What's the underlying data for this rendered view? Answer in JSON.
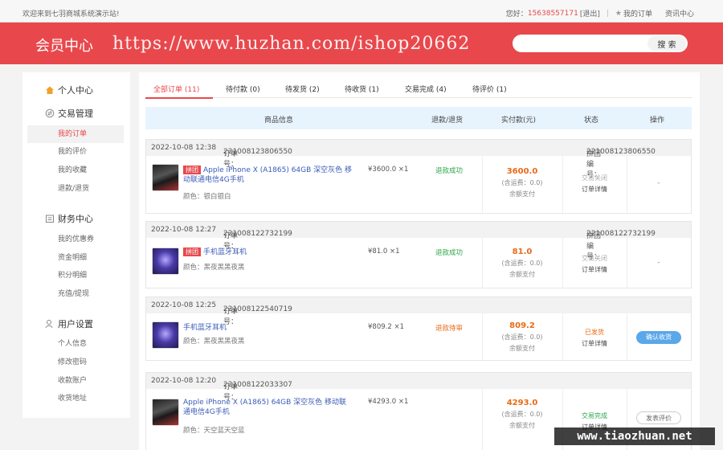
{
  "topbar": {
    "welcome": "欢迎来到七羽商城系统演示站!",
    "greeting": "您好：",
    "phone": "15638557171",
    "logout": "[退出]",
    "my_orders": "我的订单",
    "news": "资讯中心"
  },
  "header": {
    "title": "会员中心",
    "watermark": "https://www.huzhan.com/ishop20662"
  },
  "search": {
    "placeholder": "",
    "button": "搜 索"
  },
  "sidebar": {
    "personal_center": "个人中心",
    "groups": [
      {
        "title": "交易管理",
        "icon": "exchange-icon",
        "items": [
          "我的订单",
          "我的评价",
          "我的收藏",
          "退款/退货"
        ]
      },
      {
        "title": "财务中心",
        "icon": "wallet-icon",
        "items": [
          "我的优惠券",
          "资金明细",
          "积分明细",
          "充值/提现"
        ]
      },
      {
        "title": "用户设置",
        "icon": "user-icon",
        "items": [
          "个人信息",
          "修改密码",
          "收款账户",
          "收货地址"
        ]
      }
    ],
    "active_item": "我的订单"
  },
  "tabs": [
    {
      "label": "全部订单",
      "count": "(11)"
    },
    {
      "label": "待付款",
      "count": "(0)"
    },
    {
      "label": "待发货",
      "count": "(2)"
    },
    {
      "label": "待收货",
      "count": "(1)"
    },
    {
      "label": "交易完成",
      "count": "(4)"
    },
    {
      "label": "待评价",
      "count": "(1)"
    }
  ],
  "table_headers": [
    "商品信息",
    "退款/退货",
    "实付款(元)",
    "状态",
    "操作"
  ],
  "orders": [
    {
      "time": "2022-10-08 12:38",
      "order_no_label": "订单号：",
      "order_no": "221008123806550",
      "group_label": "拼团编号：",
      "group_no": "221008123806550",
      "badge": "拼团",
      "name": "Apple iPhone X (A1865) 64GB 深空灰色 移动联通电信4G手机",
      "attr": "颜色：银白银白",
      "price": "¥3600.0",
      "qty": "×1",
      "refund": "退款成功",
      "amount": "3600.0",
      "shipping": "(含运费：0.0)",
      "pay_method": "余额支付",
      "status": "交易关闭",
      "detail": "订单详情",
      "op": "-"
    },
    {
      "time": "2022-10-08 12:27",
      "order_no_label": "订单号：",
      "order_no": "221008122732199",
      "group_label": "拼团编号：",
      "group_no": "221008122732199",
      "badge": "拼团",
      "name": "手机蓝牙耳机",
      "attr": "颜色：黑夜黑黑夜黑",
      "price": "¥81.0",
      "qty": "×1",
      "refund": "退款成功",
      "amount": "81.0",
      "shipping": "(含运费：0.0)",
      "pay_method": "余额支付",
      "status": "交易关闭",
      "detail": "订单详情",
      "op": "-"
    },
    {
      "time": "2022-10-08 12:25",
      "order_no_label": "订单号：",
      "order_no": "221008122540719",
      "name": "手机蓝牙耳机",
      "attr": "颜色：黑夜黑黑夜黑",
      "price": "¥809.2",
      "qty": "×1",
      "refund": "退款待审",
      "amount": "809.2",
      "shipping": "(含运费：0.0)",
      "pay_method": "余额支付",
      "status": "已发货",
      "detail": "订单详情",
      "op": "确认收货"
    },
    {
      "time": "2022-10-08 12:20",
      "order_no_label": "订单号：",
      "order_no": "221008122033307",
      "name": "Apple iPhone X (A1865) 64GB 深空灰色 移动联通电信4G手机",
      "attr": "颜色：天空蓝天空蓝",
      "price": "¥4293.0",
      "qty": "×1",
      "amount": "4293.0",
      "shipping": "(含运费：0.0)",
      "pay_method": "余额支付",
      "status": "交易完成",
      "detail": "订单详情",
      "op": "发表评价"
    }
  ],
  "site_watermark": "www.tiaozhuan.net",
  "colors": {
    "brand_red": "#e8484c",
    "price_orange": "#e86a16",
    "success_green": "#2aa64a",
    "button_blue": "#5aa7ea"
  }
}
